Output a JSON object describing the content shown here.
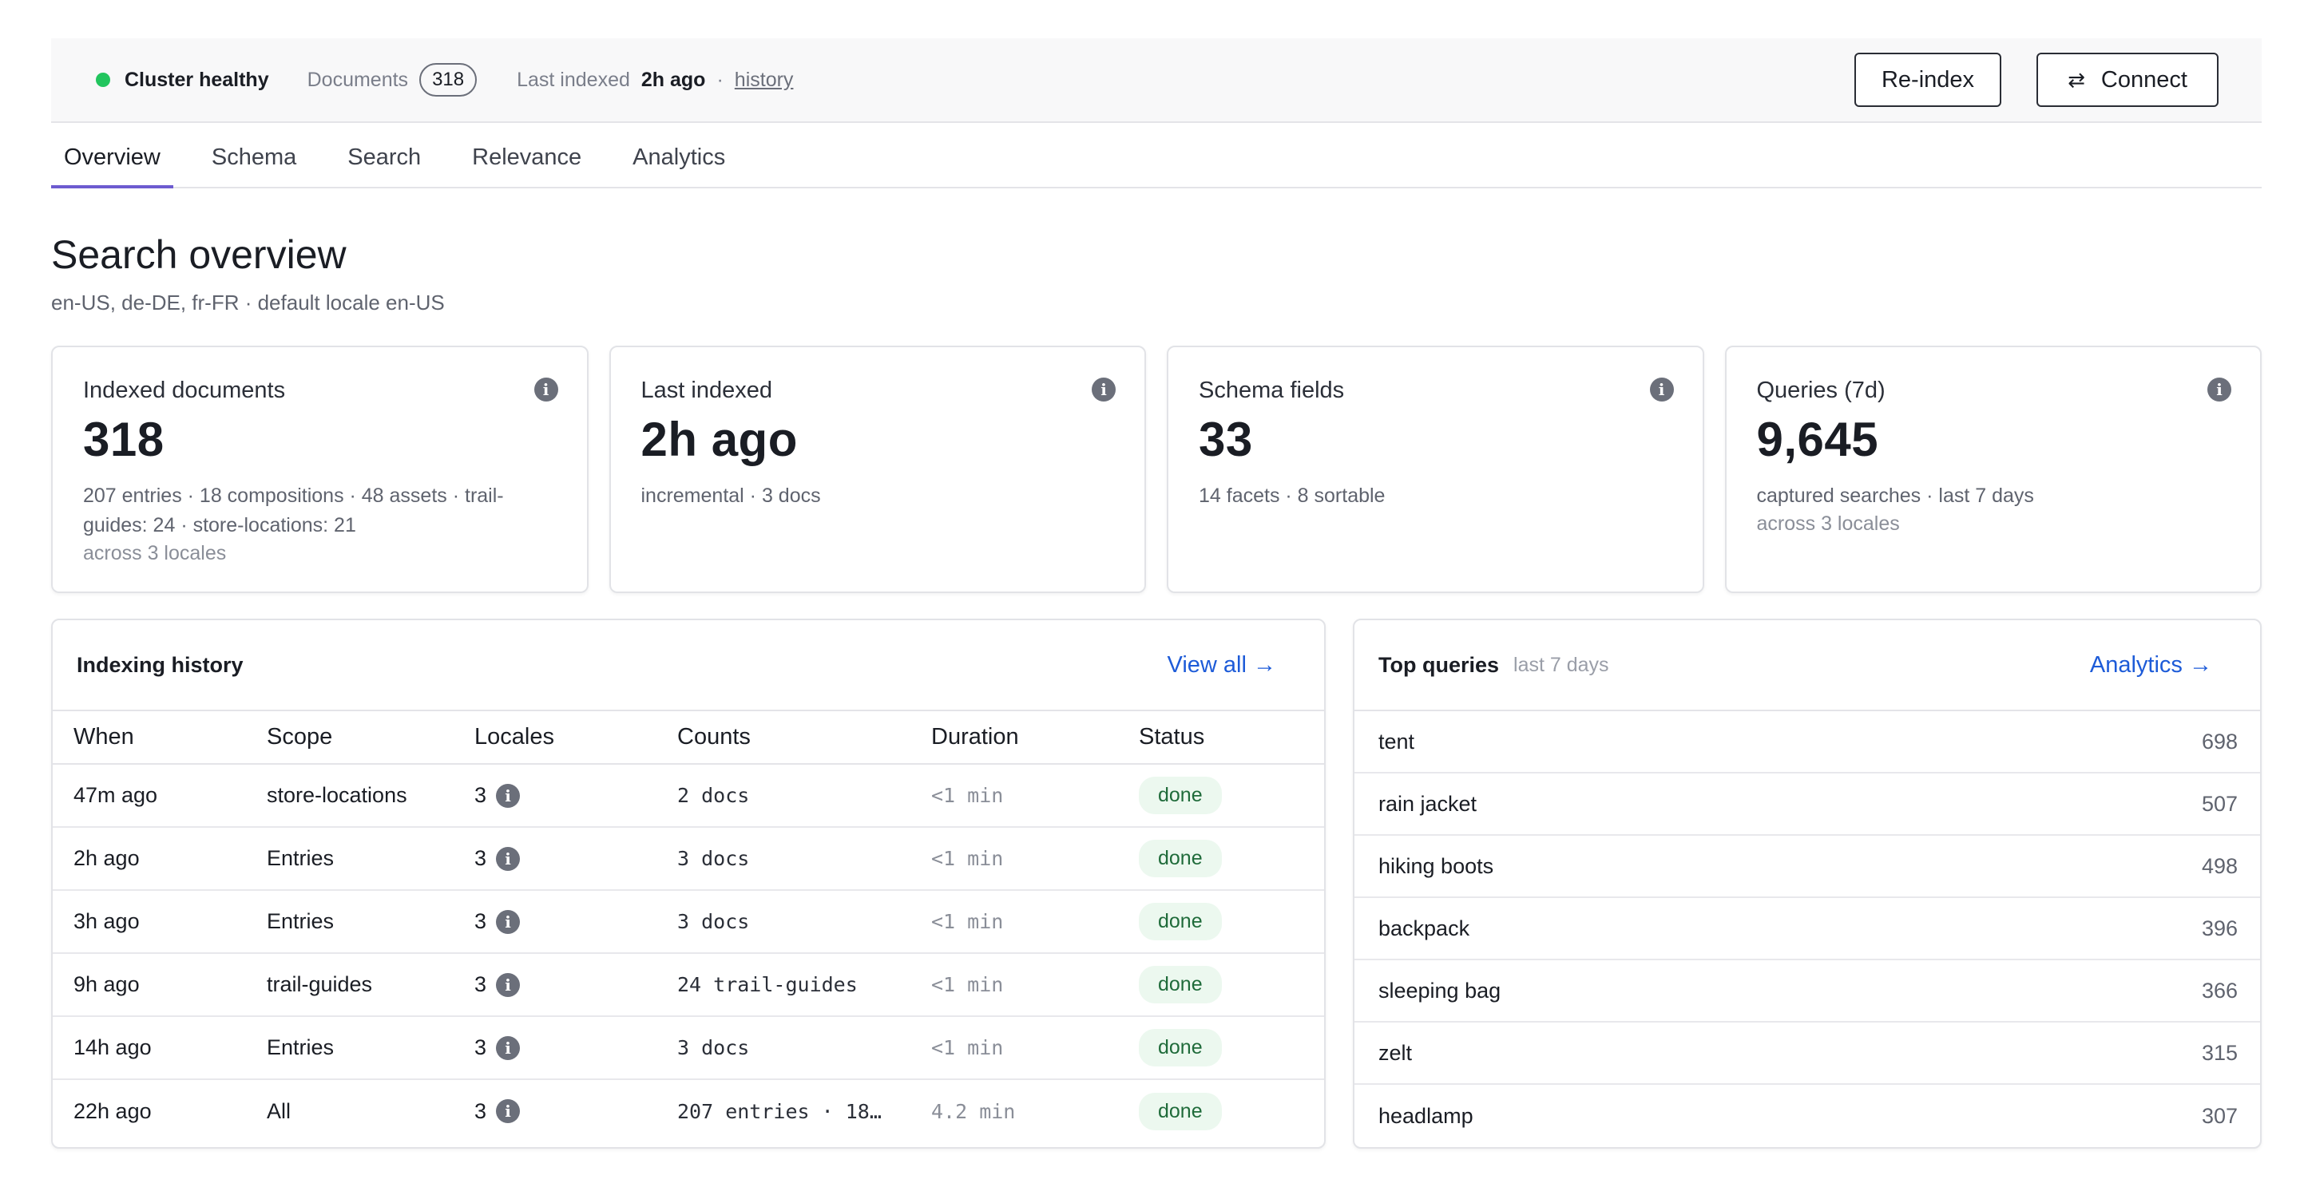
{
  "status": {
    "health": "Cluster healthy",
    "documents_label": "Documents",
    "documents_count": "318",
    "last_indexed_label": "Last indexed",
    "last_indexed_value": "2h ago",
    "separator": "·",
    "history_link": "history",
    "health_color": "#22c55e"
  },
  "actions": {
    "reindex": "Re-index",
    "connect": "Connect",
    "connect_icon": "⇄"
  },
  "tabs": [
    {
      "label": "Overview",
      "active": true
    },
    {
      "label": "Schema",
      "active": false
    },
    {
      "label": "Search",
      "active": false
    },
    {
      "label": "Relevance",
      "active": false
    },
    {
      "label": "Analytics",
      "active": false
    }
  ],
  "page": {
    "title": "Search overview",
    "subtitle": "en-US, de-DE, fr-FR · default locale en-US"
  },
  "cards": [
    {
      "label": "Indexed documents",
      "value": "318",
      "detail": "207 entries · 18 compositions · 48 assets · trail-guides: 24 · store-locations: 21",
      "note": "across 3 locales"
    },
    {
      "label": "Last indexed",
      "value": "2h ago",
      "detail": "incremental · 3 docs",
      "note": ""
    },
    {
      "label": "Schema fields",
      "value": "33",
      "detail": "14 facets · 8 sortable",
      "note": ""
    },
    {
      "label": "Queries (7d)",
      "value": "9,645",
      "detail": "captured searches · last 7 days",
      "note": "across 3 locales"
    }
  ],
  "history": {
    "title": "Indexing history",
    "view_all": "View all →",
    "columns": [
      "When",
      "Scope",
      "Locales",
      "Counts",
      "Duration",
      "Status"
    ],
    "rows": [
      {
        "when": "47m ago",
        "scope": "store-locations",
        "locales": "3",
        "counts": "2 docs",
        "duration": "<1 min",
        "status": "done"
      },
      {
        "when": "2h ago",
        "scope": "Entries",
        "locales": "3",
        "counts": "3 docs",
        "duration": "<1 min",
        "status": "done"
      },
      {
        "when": "3h ago",
        "scope": "Entries",
        "locales": "3",
        "counts": "3 docs",
        "duration": "<1 min",
        "status": "done"
      },
      {
        "when": "9h ago",
        "scope": "trail-guides",
        "locales": "3",
        "counts": "24 trail-guides",
        "duration": "<1 min",
        "status": "done"
      },
      {
        "when": "14h ago",
        "scope": "Entries",
        "locales": "3",
        "counts": "3 docs",
        "duration": "<1 min",
        "status": "done"
      },
      {
        "when": "22h ago",
        "scope": "All",
        "locales": "3",
        "counts": "207 entries · 18…",
        "duration": "4.2 min",
        "status": "done"
      }
    ]
  },
  "top_queries": {
    "title": "Top queries",
    "hint": "last 7 days",
    "link": "Analytics →",
    "items": [
      {
        "query": "tent",
        "count": "698"
      },
      {
        "query": "rain jacket",
        "count": "507"
      },
      {
        "query": "hiking boots",
        "count": "498"
      },
      {
        "query": "backpack",
        "count": "396"
      },
      {
        "query": "sleeping bag",
        "count": "366"
      },
      {
        "query": "zelt",
        "count": "315"
      },
      {
        "query": "headlamp",
        "count": "307"
      }
    ]
  }
}
